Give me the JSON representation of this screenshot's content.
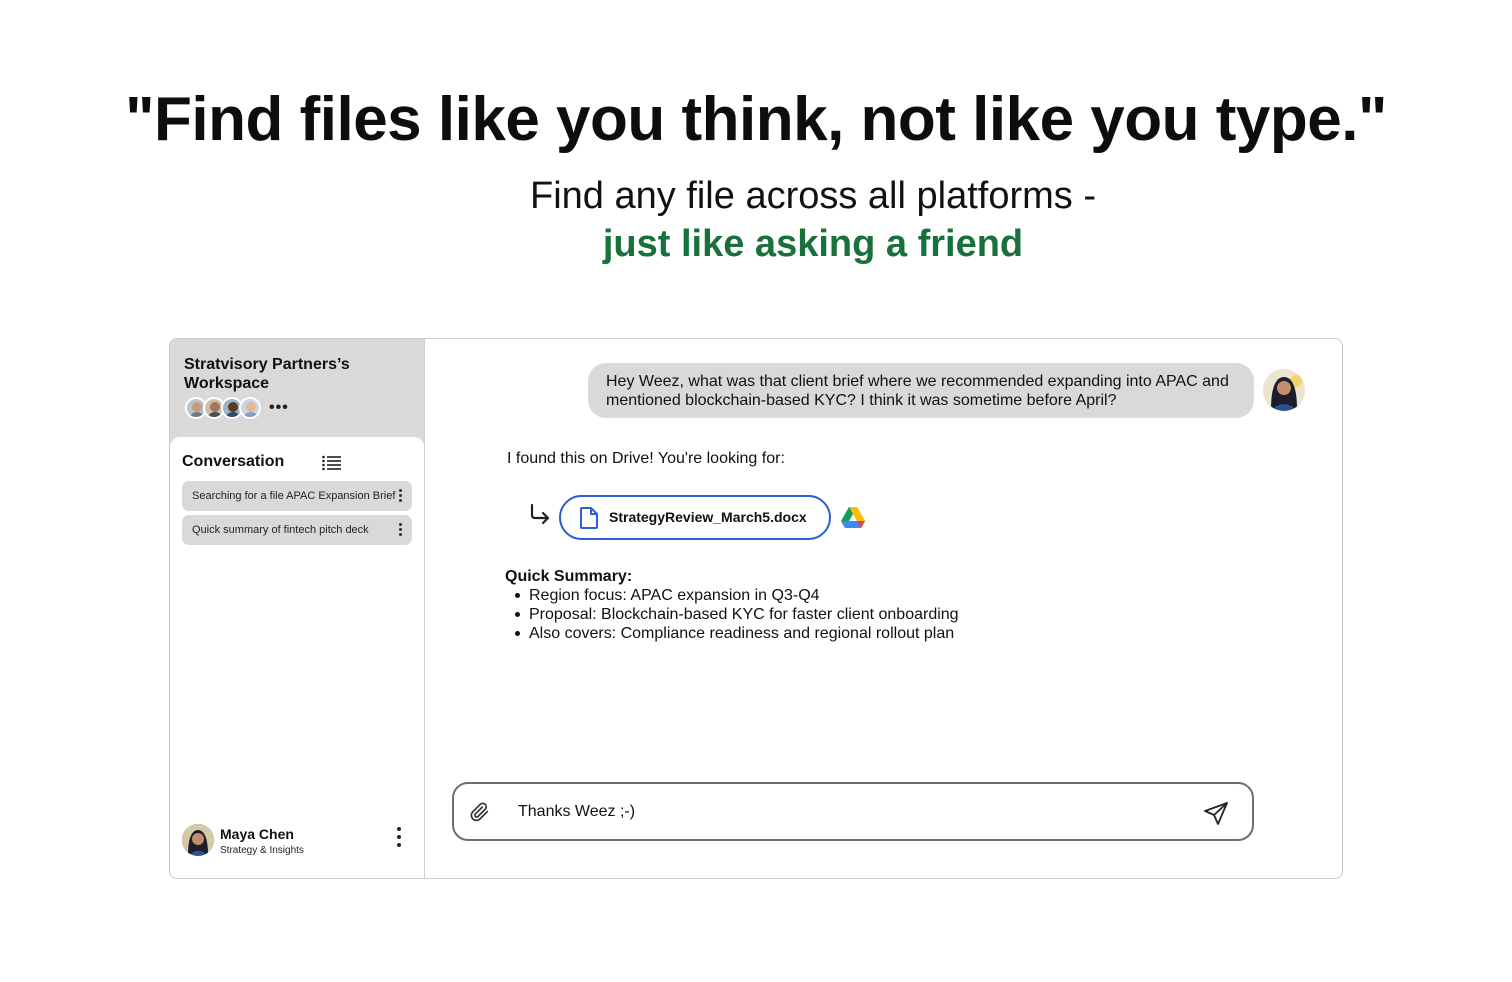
{
  "hero": {
    "headline": "\"Find files like you think, not like you type.\"",
    "subline": "Find any file across all platforms -",
    "subline_highlight": "just like asking a friend"
  },
  "workspace": {
    "name": "Stratvisory Partners’s Workspace",
    "more_label": "•••"
  },
  "sidebar": {
    "section_title": "Conversation",
    "conversations": [
      {
        "label": "Searching for a file APAC Expansion Brief"
      },
      {
        "label": "Quick summary of fintech pitch deck"
      }
    ],
    "user": {
      "name": "Maya Chen",
      "role": "Strategy & Insights"
    }
  },
  "chat": {
    "user_message": "Hey Weez, what was that client brief where we recommended expanding into APAC and mentioned blockchain-based KYC? I think it was sometime before April?",
    "bot_intro": "I found this on Drive! You're looking for:",
    "file": {
      "name": "StrategyReview_March5.docx",
      "source_icon": "google-drive-icon"
    },
    "summary_title": "Quick Summary:",
    "summary_items": [
      "Region focus: APAC expansion in Q3-Q4",
      "Proposal: Blockchain-based KYC for faster client onboarding",
      "Also covers: Compliance readiness and regional rollout plan"
    ]
  },
  "composer": {
    "value": "Thanks Weez ;-)"
  },
  "colors": {
    "accent_green": "#18713a",
    "chip_border": "#2f5fd6",
    "bubble_gray": "#d9d9d9"
  }
}
